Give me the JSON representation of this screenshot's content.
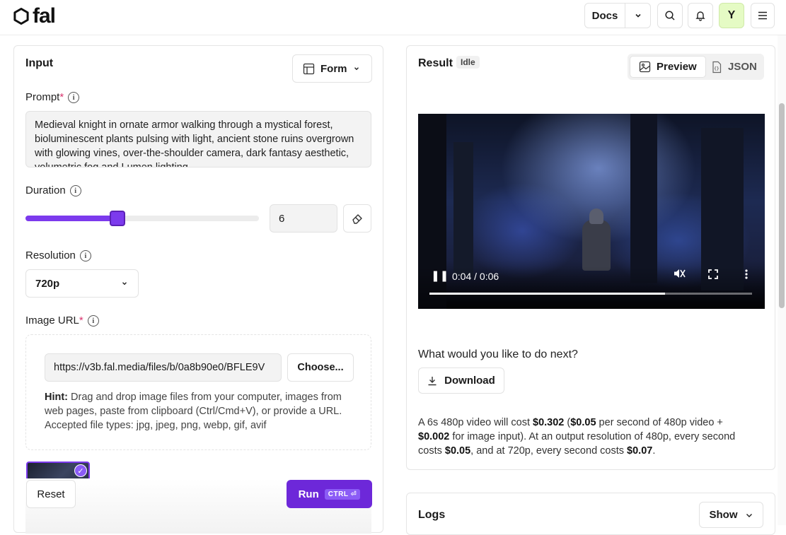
{
  "header": {
    "logo_text": "fal",
    "docs_label": "Docs",
    "avatar_initial": "Y"
  },
  "input_panel": {
    "title": "Input",
    "form_toggle_label": "Form",
    "prompt": {
      "label": "Prompt",
      "required_mark": "*",
      "value": "Medieval knight in ornate armor walking through a mystical forest, bioluminescent plants pulsing with light, ancient stone ruins overgrown with glowing vines, over-the-shoulder camera, dark fantasy aesthetic, volumetric fog and Lumen lighting"
    },
    "duration": {
      "label": "Duration",
      "value": "6",
      "slider_fraction": 0.36
    },
    "resolution": {
      "label": "Resolution",
      "selected": "720p"
    },
    "image_url": {
      "label": "Image URL",
      "required_mark": "*",
      "value": "https://v3b.fal.media/files/b/0a8b90e0/BFLE9V",
      "choose_label": "Choose...",
      "hint_bold": "Hint:",
      "hint_text": " Drag and drop image files from your computer, images from web pages, paste from clipboard (Ctrl/Cmd+V), or provide a URL. Accepted file types: jpg, jpeg, png, webp, gif, avif"
    },
    "reset_label": "Reset",
    "run_label": "Run",
    "run_shortcut": "CTRL ⏎"
  },
  "result_panel": {
    "title": "Result",
    "status_badge": "Idle",
    "tab_preview": "Preview",
    "tab_json": "JSON",
    "video": {
      "time": "0:04 / 0:06",
      "progress_fraction": 0.73
    },
    "next_question": "What would you like to do next?",
    "download_label": "Download",
    "cost": {
      "p1": "A 6s 480p video will cost ",
      "b1": "$0.302",
      "p2": " (",
      "b2": "$0.05",
      "p3": " per second of 480p video + ",
      "b3": "$0.002",
      "p4": " for image input). At an output resolution of 480p, every second costs ",
      "b4": "$0.05",
      "p5": ", and at 720p, every second costs ",
      "b5": "$0.07",
      "p6": "."
    }
  },
  "logs_panel": {
    "title": "Logs",
    "show_label": "Show"
  },
  "colors": {
    "accent": "#6d28d9",
    "avatar_bg": "#e5fbc4"
  }
}
